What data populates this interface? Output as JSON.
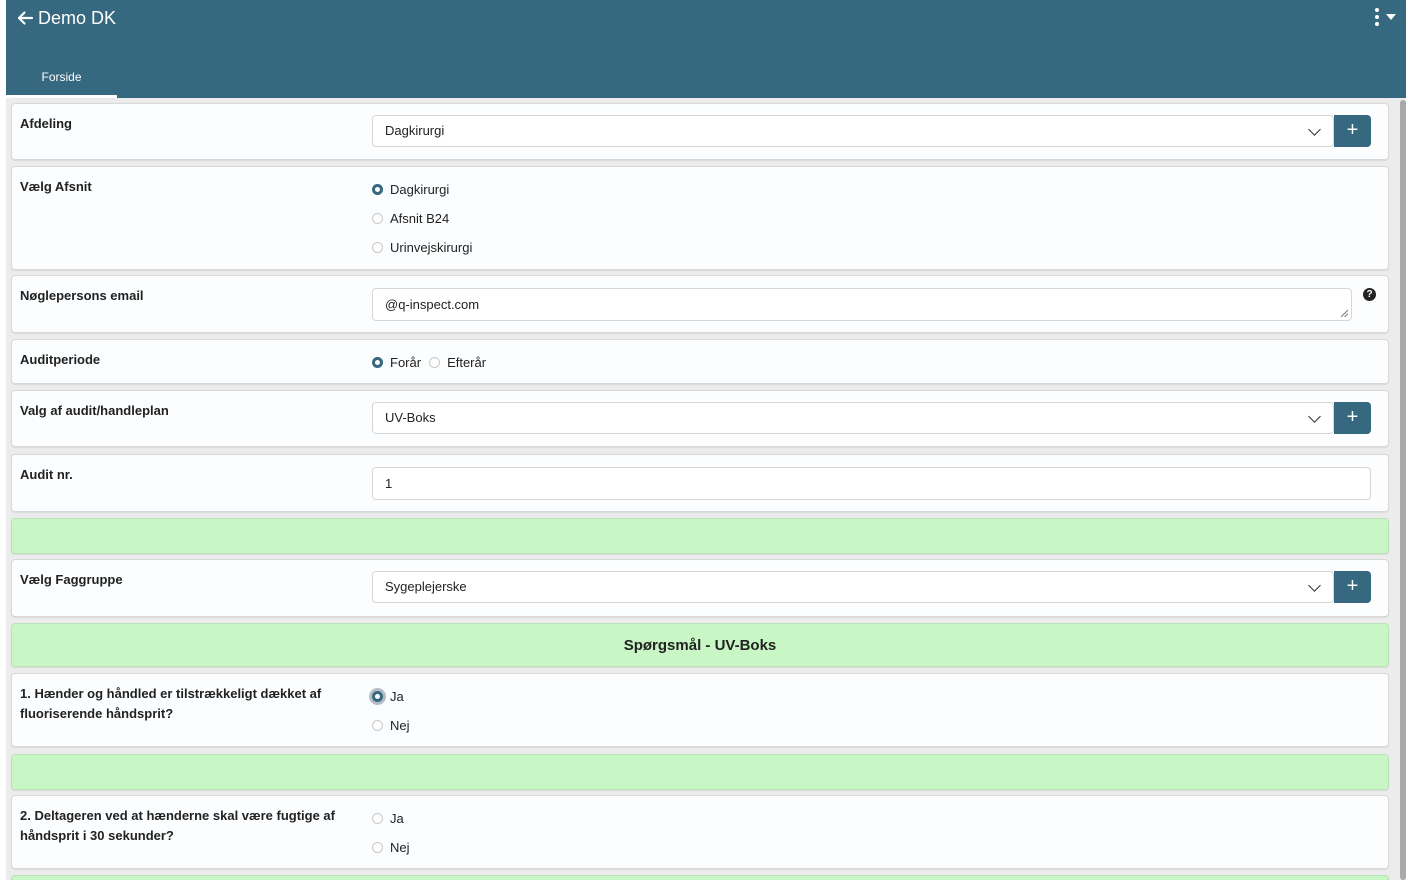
{
  "header": {
    "title": "Demo DK",
    "tab": "Forside"
  },
  "form": {
    "afdeling": {
      "label": "Afdeling",
      "value": "Dagkirurgi"
    },
    "afsnit": {
      "label": "Vælg Afsnit",
      "options": [
        "Dagkirurgi",
        "Afsnit B24",
        "Urinvejskirurgi"
      ],
      "selected": "Dagkirurgi"
    },
    "email": {
      "label": "Nøglepersons email",
      "value": "@q-inspect.com",
      "help": "?"
    },
    "auditperiode": {
      "label": "Auditperiode",
      "options": [
        "Forår",
        "Efterår"
      ],
      "selected": "Forår"
    },
    "audit_valg": {
      "label": "Valg af audit/handleplan",
      "value": "UV-Boks"
    },
    "audit_nr": {
      "label": "Audit nr.",
      "value": "1"
    },
    "faggruppe": {
      "label": "Vælg Faggruppe",
      "value": "Sygeplejerske"
    },
    "section_title": "Spørgsmål - UV-Boks",
    "questions": [
      {
        "label": "1. Hænder og håndled er tilstrækkeligt dækket af fluoriserende håndsprit?",
        "options": [
          "Ja",
          "Nej"
        ],
        "selected": "Ja"
      },
      {
        "label": "2. Deltageren ved at hænderne skal være fugtige af håndsprit i 30 sekunder?",
        "options": [
          "Ja",
          "Nej"
        ],
        "selected": ""
      }
    ]
  },
  "colors": {
    "primary": "#36687f",
    "section_green": "#c8f7c5"
  }
}
